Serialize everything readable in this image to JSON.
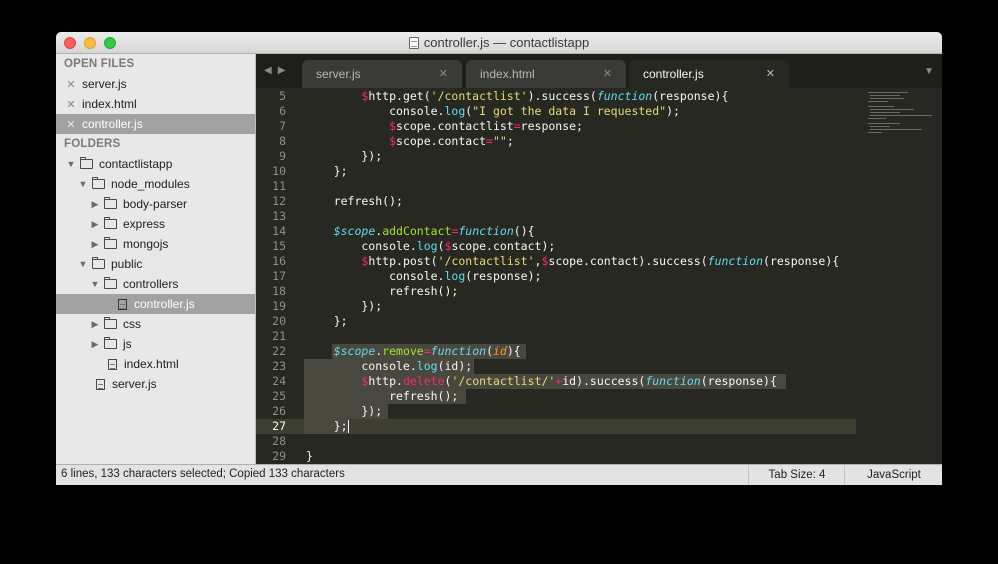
{
  "window": {
    "title": "controller.js — contactlistapp"
  },
  "sidebar": {
    "open_files_heading": "OPEN FILES",
    "open_files": [
      {
        "label": "server.js",
        "selected": false
      },
      {
        "label": "index.html",
        "selected": false
      },
      {
        "label": "controller.js",
        "selected": true
      }
    ],
    "folders_heading": "FOLDERS",
    "tree": [
      {
        "label": "contactlistapp",
        "kind": "folder",
        "expanded": true,
        "depth": 0
      },
      {
        "label": "node_modules",
        "kind": "folder",
        "expanded": true,
        "depth": 1
      },
      {
        "label": "body-parser",
        "kind": "folder",
        "expanded": false,
        "depth": 2
      },
      {
        "label": "express",
        "kind": "folder",
        "expanded": false,
        "depth": 2
      },
      {
        "label": "mongojs",
        "kind": "folder",
        "expanded": false,
        "depth": 2
      },
      {
        "label": "public",
        "kind": "folder",
        "expanded": true,
        "depth": 1
      },
      {
        "label": "controllers",
        "kind": "folder",
        "expanded": true,
        "depth": 2
      },
      {
        "label": "controller.js",
        "kind": "file",
        "depth": 3,
        "selected": true
      },
      {
        "label": "css",
        "kind": "folder",
        "expanded": false,
        "depth": 2
      },
      {
        "label": "js",
        "kind": "folder",
        "expanded": false,
        "depth": 2
      },
      {
        "label": "index.html",
        "kind": "file",
        "depth": 2
      },
      {
        "label": "server.js",
        "kind": "file",
        "depth": 1
      }
    ]
  },
  "tabs": [
    {
      "label": "server.js",
      "active": false
    },
    {
      "label": "index.html",
      "active": false
    },
    {
      "label": "controller.js",
      "active": true
    }
  ],
  "editor": {
    "line_numbers": [
      "5",
      "6",
      "7",
      "8",
      "9",
      "10",
      "11",
      "12",
      "13",
      "14",
      "15",
      "16",
      "17",
      "18",
      "19",
      "20",
      "21",
      "22",
      "23",
      "24",
      "25",
      "26",
      "27",
      "28",
      "29"
    ],
    "current_line": "27"
  },
  "statusbar": {
    "message": "6 lines, 133 characters selected; Copied 133 characters",
    "tab_size": "Tab Size: 4",
    "language": "JavaScript"
  },
  "colors": {
    "editor_bg": "#272822",
    "keyword": "#66d9ef",
    "string": "#e6db74",
    "operator": "#f92672",
    "function": "#a6e22e",
    "param": "#fd971f"
  }
}
